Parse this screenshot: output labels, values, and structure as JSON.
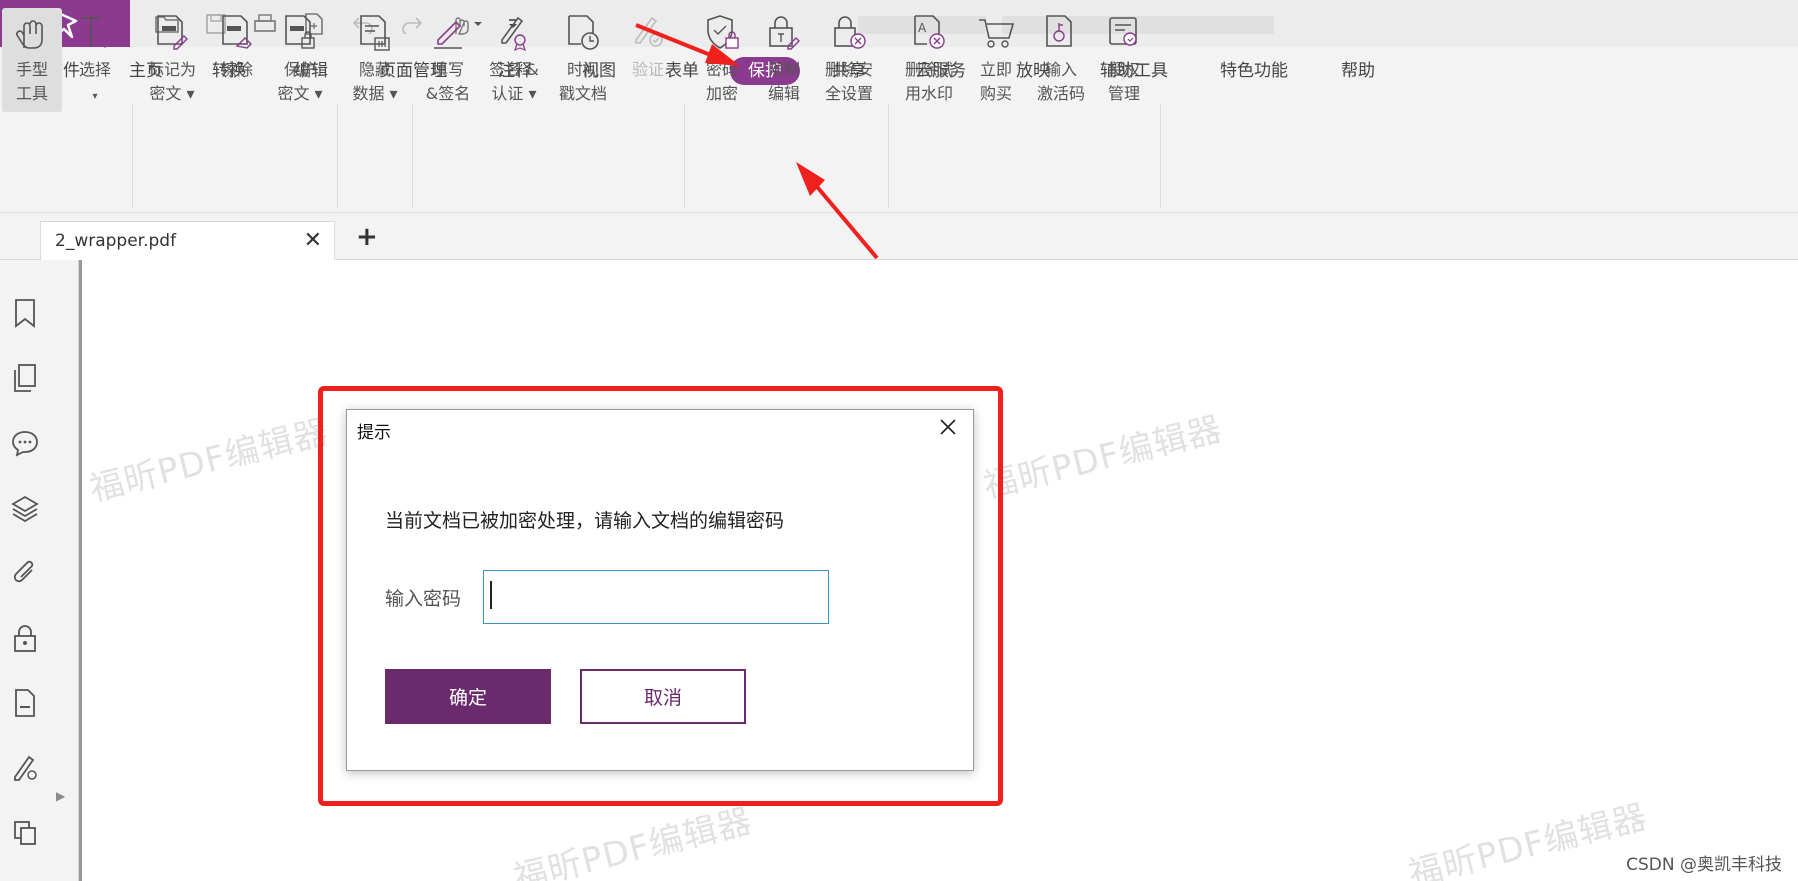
{
  "quick_access": {
    "icons": [
      "open-folder-icon",
      "save-icon",
      "print-icon",
      "new-document-icon",
      "undo-icon",
      "redo-icon",
      "hand-dropdown-icon",
      "customize-icon"
    ]
  },
  "menu": {
    "tabs": [
      "文件",
      "主页",
      "转换",
      "编辑",
      "页面管理",
      "注释",
      "视图",
      "表单",
      "保护",
      "共享",
      "云服务",
      "放映",
      "辅助工具",
      "特色功能",
      "帮助"
    ],
    "active_tab": "保护"
  },
  "ribbon": {
    "hand_tool": [
      "手型",
      "工具"
    ],
    "select": [
      "选择",
      "▾"
    ],
    "mark_redact": [
      "标记为",
      "密文 ▾"
    ],
    "erase": [
      "擦除",
      ""
    ],
    "protect_redact": [
      "保护",
      "密文 ▾"
    ],
    "hide_data": [
      "隐藏",
      "数据 ▾"
    ],
    "fill_sign": [
      "填写",
      "&签名"
    ],
    "sign_certify": [
      "签名 &",
      "认证 ▾"
    ],
    "timestamp": [
      "时间",
      "戳文档"
    ],
    "verify": [
      "验证",
      ""
    ],
    "password_encrypt": [
      "密码",
      "加密"
    ],
    "restrict_edit": [
      "限制",
      "编辑"
    ],
    "remove_security": [
      "删除安",
      "全设置"
    ],
    "remove_watermark": [
      "删除试",
      "用水印"
    ],
    "buy_now": [
      "立即",
      "购买"
    ],
    "activation_code": [
      "输入",
      "激活码"
    ],
    "license_manage": [
      "授权",
      "管理"
    ]
  },
  "document_tab": {
    "filename": "2_wrapper.pdf",
    "close": "✕",
    "add": "+"
  },
  "sidebar": {
    "icons": [
      "bookmark-icon",
      "pages-icon",
      "comments-icon",
      "layers-icon",
      "attachment-icon",
      "security-icon",
      "document-icon",
      "signature-icon",
      "compare-icon"
    ]
  },
  "watermark_text": "福昕PDF编辑器",
  "dialog": {
    "title": "提示",
    "message": "当前文档已被加密处理，请输入文档的编辑密码",
    "password_label": "输入密码",
    "password_value": "",
    "ok_label": "确定",
    "cancel_label": "取消"
  },
  "credit": "CSDN @奥凯丰科技",
  "colors": {
    "brand": "#8b3a8f",
    "button_primary": "#6a2a6b",
    "highlight_red": "#f0201c",
    "input_border": "#3c8fc7"
  }
}
